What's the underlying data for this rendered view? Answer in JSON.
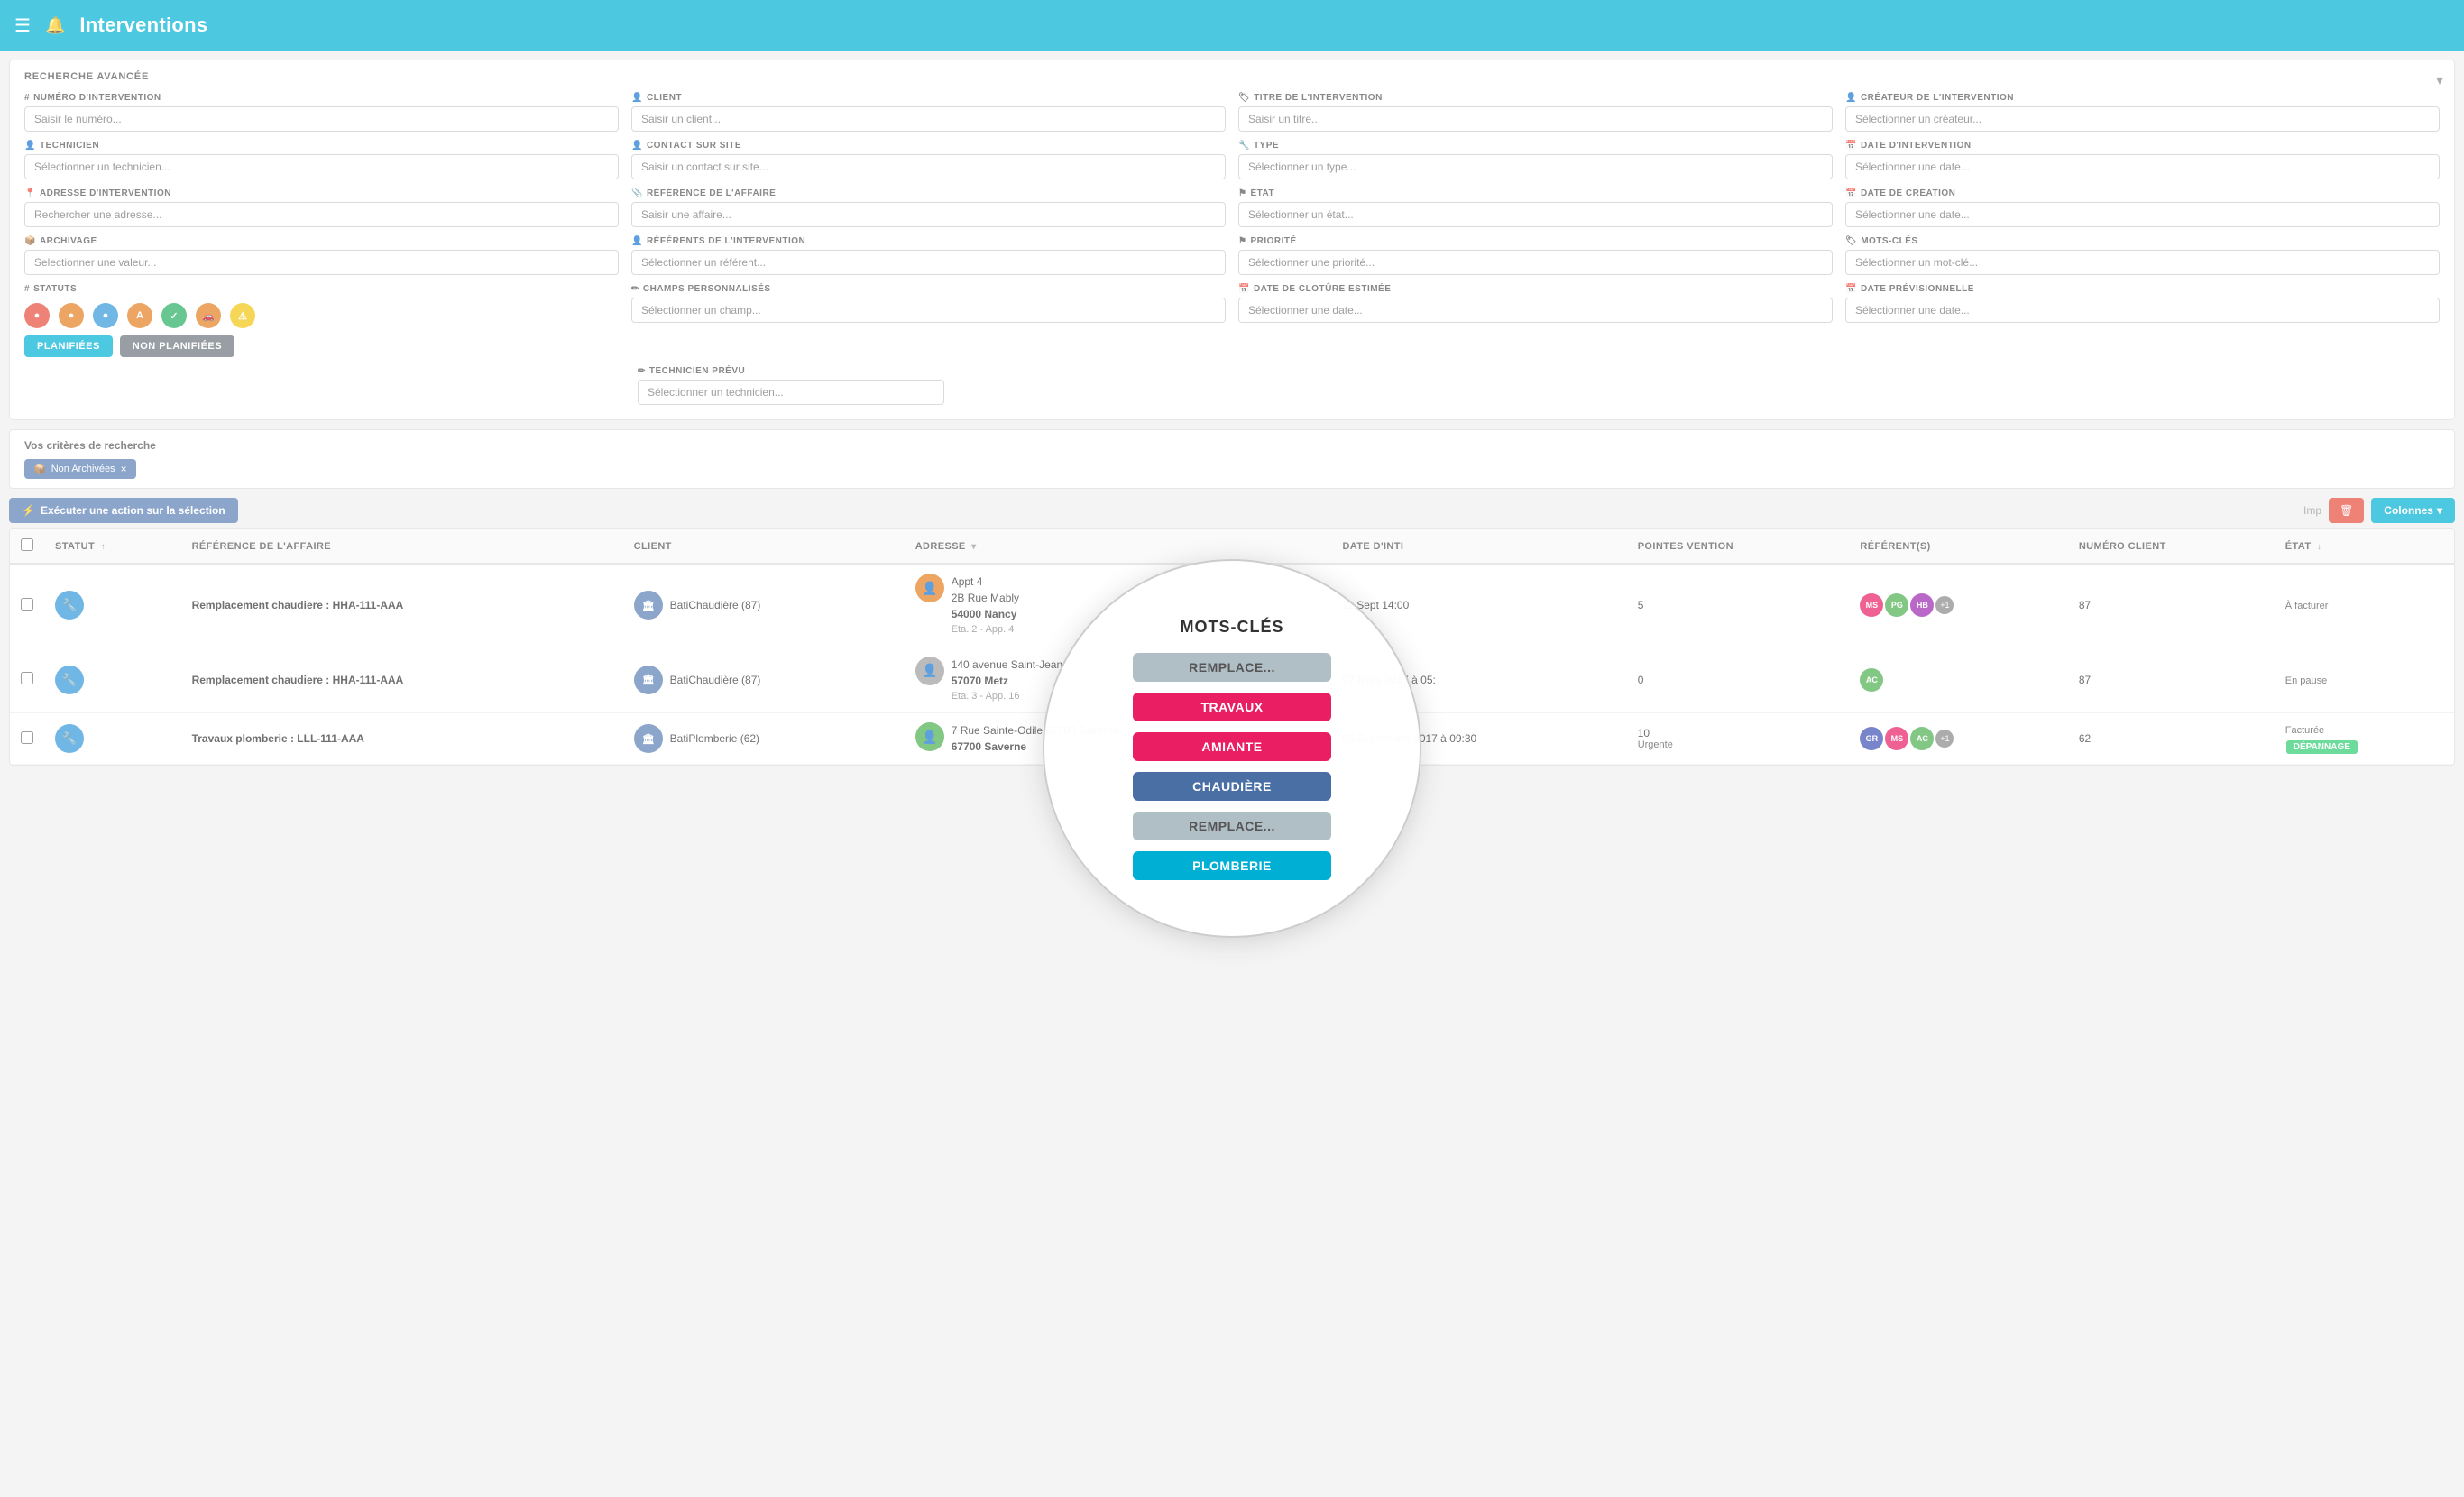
{
  "header": {
    "title": "Interventions",
    "hamburger": "☰",
    "bell": "🔔"
  },
  "search_panel": {
    "title": "RECHERCHE AVANCÉE",
    "collapse": "▾",
    "fields": [
      {
        "id": "num_intervention",
        "label": "NUMÉRO D'INTERVENTION",
        "icon": "#",
        "placeholder": "Saisir le numéro..."
      },
      {
        "id": "client",
        "label": "CLIENT",
        "icon": "👤",
        "placeholder": "Saisir un client..."
      },
      {
        "id": "titre",
        "label": "TITRE DE L'INTERVENTION",
        "icon": "🏷",
        "placeholder": "Saisir un titre..."
      },
      {
        "id": "createur",
        "label": "CRÉATEUR DE L'INTERVENTION",
        "icon": "👤",
        "placeholder": "Sélectionner un créateur..."
      },
      {
        "id": "technicien",
        "label": "TECHNICIEN",
        "icon": "👤",
        "placeholder": "Sélectionner un technicien..."
      },
      {
        "id": "contact_site",
        "label": "CONTACT SUR SITE",
        "icon": "👤",
        "placeholder": "Saisir un contact sur site..."
      },
      {
        "id": "type",
        "label": "TYPE",
        "icon": "🔧",
        "placeholder": "Sélectionner un type..."
      },
      {
        "id": "date_intervention",
        "label": "DATE D'INTERVENTION",
        "icon": "📅",
        "placeholder": "Sélectionner une date..."
      },
      {
        "id": "adresse",
        "label": "ADRESSE D'INTERVENTION",
        "icon": "📍",
        "placeholder": "Rechercher une adresse..."
      },
      {
        "id": "affaire",
        "label": "RÉFÉRENCE DE L'AFFAIRE",
        "icon": "📎",
        "placeholder": "Saisir une affaire..."
      },
      {
        "id": "etat",
        "label": "ÉTAT",
        "icon": "⚑",
        "placeholder": "Sélectionner un état..."
      },
      {
        "id": "date_creation",
        "label": "DATE DE CRÉATION",
        "icon": "📅",
        "placeholder": "Sélectionner une date..."
      },
      {
        "id": "archivage",
        "label": "ARCHIVAGE",
        "icon": "📦",
        "placeholder": "Selectionner une valeur..."
      },
      {
        "id": "referents",
        "label": "RÉFÉRENTS DE L'INTERVENTION",
        "icon": "👤",
        "placeholder": "Sélectionner un référent..."
      },
      {
        "id": "priorite",
        "label": "PRIORITÉ",
        "icon": "⚑",
        "placeholder": "Sélectionner une priorité..."
      },
      {
        "id": "mots_cles",
        "label": "MOTS-CLÉS",
        "icon": "🏷",
        "placeholder": "Sélectionner un mot-clé..."
      },
      {
        "id": "statuts_label",
        "label": "STATUTS",
        "icon": "#",
        "placeholder": ""
      },
      {
        "id": "champs_perso",
        "label": "CHAMPS PERSONNALISÉS",
        "icon": "✏",
        "placeholder": "Sélectionner un champ..."
      },
      {
        "id": "date_cloture",
        "label": "DATE DE CLOTÛRE ESTIMÉE",
        "icon": "📅",
        "placeholder": "Sélectionner une date..."
      },
      {
        "id": "date_prev",
        "label": "DATE PRÉVISIONNELLE",
        "icon": "📅",
        "placeholder": "Sélectionner une date..."
      },
      {
        "id": "technicien_prevu",
        "label": "TECHNICIEN PRÉVU",
        "icon": "✏",
        "placeholder": "Sélectionner un technicien..."
      }
    ],
    "statuts": [
      {
        "color": "#e74c3c",
        "symbol": "●"
      },
      {
        "color": "#e67e22",
        "symbol": "●"
      },
      {
        "color": "#3498db",
        "symbol": "●"
      },
      {
        "color": "#e67e22",
        "symbol": "A"
      },
      {
        "color": "#27ae60",
        "symbol": "✓"
      },
      {
        "color": "#e67e22",
        "symbol": "🚗"
      },
      {
        "color": "#f1c40f",
        "symbol": "⚠"
      }
    ],
    "plan_buttons": [
      {
        "label": "PLANIFIÉES",
        "class": "planifiees"
      },
      {
        "label": "NON PLANIFIÉES",
        "class": "non-planifiees"
      }
    ]
  },
  "criteria": {
    "title": "Vos critères de recherche",
    "tags": [
      {
        "label": "Non Archivées",
        "icon": "📦",
        "removable": true
      }
    ]
  },
  "toolbar": {
    "action_label": "Exécuter une action sur la sélection",
    "columns_label": "Colonnes",
    "imp_icon": "🗑"
  },
  "table": {
    "columns": [
      {
        "id": "checkbox",
        "label": ""
      },
      {
        "id": "statut",
        "label": "STATUT",
        "sortable": true,
        "sort": "↑"
      },
      {
        "id": "reference",
        "label": "RÉFÉRENCE DE L'AFFAIRE",
        "sortable": false
      },
      {
        "id": "client",
        "label": "CLIENT",
        "sortable": false
      },
      {
        "id": "adresse",
        "label": "ADRESSE",
        "sortable": false
      },
      {
        "id": "date",
        "label": "DATE D'INTI",
        "sortable": false
      },
      {
        "id": "pointes",
        "label": "POINTES VENTION",
        "sortable": false
      },
      {
        "id": "referents",
        "label": "RÉFÉRENT(S)",
        "sortable": false
      },
      {
        "id": "num_client",
        "label": "NUMÉRO CLIENT",
        "sortable": false
      },
      {
        "id": "etat",
        "label": "ÉTAT",
        "sortable": true,
        "sort": "↓"
      }
    ],
    "rows": [
      {
        "id": 1,
        "statut_color": "#3498db",
        "statut_icon": "🔧",
        "reference": "Remplacement chaudiere : HHA-111-AAA",
        "client_name": "BatiChaudière (87)",
        "client_color": "#5a7eb5",
        "client_icon": "🏛",
        "adresse_line1": "Appt 4",
        "adresse_line2": "2B Rue Mably",
        "adresse_city": "54000 Nancy",
        "adresse_extra": "Eta. 2 - App. 4",
        "adresse_icon": "👤",
        "adresse_icon_color": "#e67e22",
        "date": "11 Sept 14:00",
        "pointes": "5",
        "referents": [
          {
            "initials": "MS",
            "color": "#e91e63"
          },
          {
            "initials": "PG",
            "color": "#4caf50"
          },
          {
            "initials": "HB",
            "color": "#9c27b0"
          },
          {
            "extra": "+1",
            "color": "#888"
          }
        ],
        "num_client": "87",
        "etat": "À facturer",
        "kw_tags": []
      },
      {
        "id": 2,
        "statut_color": "#3498db",
        "statut_icon": "🔧",
        "reference": "Remplacement chaudiere : HHA-111-AAA",
        "client_name": "BatiChaudière (87)",
        "client_color": "#5a7eb5",
        "client_icon": "🏛",
        "adresse_line1": "140 avenue Saint-Jean",
        "adresse_line2": "",
        "adresse_city": "57070 Metz",
        "adresse_extra": "Eta. 3 - App. 16",
        "adresse_icon": "👤",
        "adresse_icon_color": "#9e9e9e",
        "date": "07 Mars 2017 à 05:",
        "pointes": "0",
        "referents": [
          {
            "initials": "AC",
            "color": "#4caf50"
          }
        ],
        "num_client": "87",
        "etat": "En pause",
        "kw_tags": []
      },
      {
        "id": 3,
        "statut_color": "#3498db",
        "statut_icon": "🔧",
        "reference": "Travaux plomberie : LLL-111-AAA",
        "client_name": "BatiPlomberie (62)",
        "client_color": "#5a7eb5",
        "client_icon": "🏛",
        "adresse_line1": "7 Rue Sainte-Odile 67700 Saverne",
        "adresse_line2": "",
        "adresse_city": "67700 Saverne",
        "adresse_extra": "",
        "adresse_icon": "👤",
        "adresse_icon_color": "#4caf50",
        "date": "05 Septembre 2017 à 09:30",
        "pointes": "10",
        "referents": [
          {
            "initials": "GR",
            "color": "#3f51b5"
          },
          {
            "initials": "MS",
            "color": "#e91e63"
          },
          {
            "initials": "AC",
            "color": "#4caf50"
          },
          {
            "extra": "+1",
            "color": "#888"
          }
        ],
        "num_client": "62",
        "etat": "Facturée",
        "priority": "Urgente",
        "kw_tags": [
          {
            "label": "DÉPANNAGE",
            "color": "#2ecc71"
          }
        ]
      }
    ]
  },
  "overlay": {
    "title": "MOTS-CLÉS",
    "keywords": [
      {
        "label": "REMPLACE...",
        "color": "#b0bec5",
        "text_color": "#555"
      },
      {
        "label": "TRAVAUX",
        "color": "#e91e63",
        "text_color": "white"
      },
      {
        "label": "AMIANTE",
        "color": "#e91e63",
        "text_color": "white"
      },
      {
        "label": "CHAUDIÈRE",
        "color": "#4a6fa5",
        "text_color": "white"
      },
      {
        "label": "REMPLACE...",
        "color": "#b0bec5",
        "text_color": "#555"
      },
      {
        "label": "PLOMBERIE",
        "color": "#00b0d4",
        "text_color": "white"
      }
    ]
  }
}
